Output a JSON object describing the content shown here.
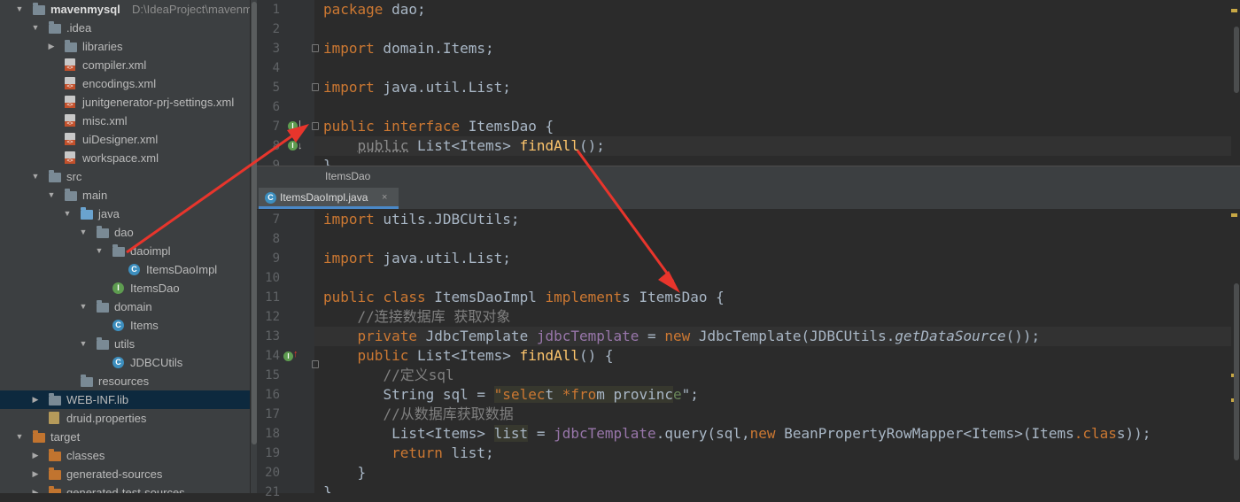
{
  "project_tree": {
    "items": [
      {
        "label": "mavenmysql",
        "path": "D:\\IdeaProject\\mavenmysql",
        "icon": "module-folder-icon",
        "expanded": true
      },
      {
        "label": ".idea",
        "icon": "folder-icon",
        "expanded": true
      },
      {
        "label": "libraries",
        "icon": "folder-icon",
        "expanded": false
      },
      {
        "label": "compiler.xml",
        "icon": "xml-file-icon"
      },
      {
        "label": "encodings.xml",
        "icon": "xml-file-icon"
      },
      {
        "label": "junitgenerator-prj-settings.xml",
        "icon": "xml-file-icon"
      },
      {
        "label": "misc.xml",
        "icon": "xml-file-icon"
      },
      {
        "label": "uiDesigner.xml",
        "icon": "xml-file-icon"
      },
      {
        "label": "workspace.xml",
        "icon": "xml-file-icon"
      },
      {
        "label": "src",
        "icon": "folder-icon",
        "expanded": true
      },
      {
        "label": "main",
        "icon": "folder-icon",
        "expanded": true
      },
      {
        "label": "java",
        "icon": "source-folder-icon",
        "expanded": true
      },
      {
        "label": "dao",
        "icon": "package-icon",
        "expanded": true
      },
      {
        "label": "daoimpl",
        "icon": "package-icon",
        "expanded": true
      },
      {
        "label": "ItemsDaoImpl",
        "icon": "class-icon"
      },
      {
        "label": "ItemsDao",
        "icon": "interface-icon"
      },
      {
        "label": "domain",
        "icon": "package-icon",
        "expanded": true
      },
      {
        "label": "Items",
        "icon": "class-icon"
      },
      {
        "label": "utils",
        "icon": "package-icon",
        "expanded": true
      },
      {
        "label": "JDBCUtils",
        "icon": "class-icon"
      },
      {
        "label": "resources",
        "icon": "resources-folder-icon"
      },
      {
        "label": "WEB-INF.lib",
        "icon": "library-icon",
        "expanded": false,
        "selected": true
      },
      {
        "label": "druid.properties",
        "icon": "properties-file-icon"
      },
      {
        "label": "target",
        "icon": "excluded-folder-icon",
        "expanded": true
      },
      {
        "label": "classes",
        "icon": "excluded-folder-icon",
        "expanded": false
      },
      {
        "label": "generated-sources",
        "icon": "excluded-folder-icon",
        "expanded": false
      },
      {
        "label": "generated-test-sources",
        "icon": "excluded-folder-icon",
        "expanded": false
      }
    ]
  },
  "top_editor": {
    "lines": [
      {
        "num": "1",
        "text": "package dao;"
      },
      {
        "num": "2",
        "text": ""
      },
      {
        "num": "3",
        "text": "import domain.Items;"
      },
      {
        "num": "4",
        "text": ""
      },
      {
        "num": "5",
        "text": "import java.util.List;"
      },
      {
        "num": "6",
        "text": ""
      },
      {
        "num": "7",
        "text": "public interface ItemsDao {"
      },
      {
        "num": "8",
        "text": "    public List<Items> findAll();"
      },
      {
        "num": "9",
        "text": "}"
      }
    ]
  },
  "breadcrumb": {
    "text": "ItemsDao"
  },
  "tab": {
    "label": "ItemsDaoImpl.java",
    "icon_letter": "C",
    "close": "×"
  },
  "bottom_editor": {
    "lines": [
      {
        "num": "7",
        "text": "import utils.JDBCUtils;"
      },
      {
        "num": "8",
        "text": ""
      },
      {
        "num": "9",
        "text": "import java.util.List;"
      },
      {
        "num": "10",
        "text": ""
      },
      {
        "num": "11",
        "text": "public class ItemsDaoImpl implements ItemsDao {"
      },
      {
        "num": "12",
        "text": "    //连接数据库 获取对象"
      },
      {
        "num": "13",
        "text": "    private JdbcTemplate jdbcTemplate = new JdbcTemplate(JDBCUtils.getDataSource());"
      },
      {
        "num": "14",
        "text": "    public List<Items> findAll() {"
      },
      {
        "num": "15",
        "text": "       //定义sql"
      },
      {
        "num": "16",
        "text": "       String sql = \"select *from province\";"
      },
      {
        "num": "17",
        "text": "       //从数据库获取数据"
      },
      {
        "num": "18",
        "text": "        List<Items> list = jdbcTemplate.query(sql,new BeanPropertyRowMapper<Items>(Items.class));"
      },
      {
        "num": "19",
        "text": "        return list;"
      },
      {
        "num": "20",
        "text": "    }"
      },
      {
        "num": "21",
        "text": "}"
      }
    ]
  },
  "icons": {
    "implemented": "I",
    "class_letter": "C",
    "interface_letter": "I",
    "arrow_down": "▼",
    "arrow_right": "▶"
  },
  "colors": {
    "keyword": "#cc7832",
    "method": "#ffc66d",
    "field": "#9876aa",
    "comment": "#808080",
    "string": "#6a8759",
    "annotation_arrow": "#e8352c"
  }
}
